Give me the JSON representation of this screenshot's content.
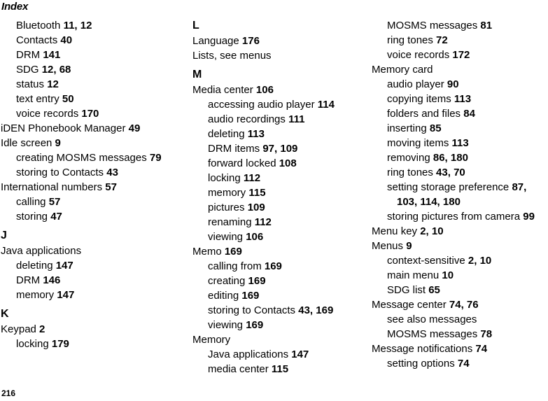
{
  "document": {
    "title": "Index",
    "page_number": "216"
  },
  "columns": [
    {
      "id": "column-1",
      "blocks": [
        {
          "type": "entry",
          "level": 1,
          "text": "Bluetooth ",
          "pages": "11, 12"
        },
        {
          "type": "entry",
          "level": 1,
          "text": "Contacts ",
          "pages": "40"
        },
        {
          "type": "entry",
          "level": 1,
          "text": "DRM ",
          "pages": "141"
        },
        {
          "type": "entry",
          "level": 1,
          "text": "SDG ",
          "pages": "12, 68"
        },
        {
          "type": "entry",
          "level": 1,
          "text": "status ",
          "pages": "12"
        },
        {
          "type": "entry",
          "level": 1,
          "text": "text entry ",
          "pages": "50"
        },
        {
          "type": "entry",
          "level": 1,
          "text": "voice records ",
          "pages": "170"
        },
        {
          "type": "entry",
          "level": 0,
          "text": "iDEN Phonebook Manager ",
          "pages": "49"
        },
        {
          "type": "entry",
          "level": 0,
          "text": "Idle screen ",
          "pages": "9"
        },
        {
          "type": "entry",
          "level": 1,
          "text": "creating MOSMS messages ",
          "pages": "79"
        },
        {
          "type": "entry",
          "level": 1,
          "text": "storing to Contacts ",
          "pages": "43"
        },
        {
          "type": "entry",
          "level": 0,
          "text": "International numbers ",
          "pages": "57"
        },
        {
          "type": "entry",
          "level": 1,
          "text": "calling ",
          "pages": "57"
        },
        {
          "type": "entry",
          "level": 1,
          "text": "storing ",
          "pages": "47"
        },
        {
          "type": "letter",
          "text": "J"
        },
        {
          "type": "entry",
          "level": 0,
          "text": "Java applications",
          "pages": ""
        },
        {
          "type": "entry",
          "level": 1,
          "text": "deleting ",
          "pages": "147"
        },
        {
          "type": "entry",
          "level": 1,
          "text": "DRM ",
          "pages": "146"
        },
        {
          "type": "entry",
          "level": 1,
          "text": "memory ",
          "pages": "147"
        },
        {
          "type": "letter",
          "text": "K"
        },
        {
          "type": "entry",
          "level": 0,
          "text": "Keypad ",
          "pages": "2"
        },
        {
          "type": "entry",
          "level": 1,
          "text": "locking ",
          "pages": "179"
        }
      ]
    },
    {
      "id": "column-2",
      "blocks": [
        {
          "type": "letter",
          "text": "L"
        },
        {
          "type": "entry",
          "level": 0,
          "text": "Language ",
          "pages": "176"
        },
        {
          "type": "entry",
          "level": 0,
          "text": "Lists, see menus",
          "pages": ""
        },
        {
          "type": "letter",
          "text": "M"
        },
        {
          "type": "entry",
          "level": 0,
          "text": "Media center ",
          "pages": "106"
        },
        {
          "type": "entry",
          "level": 1,
          "text": "accessing audio player ",
          "pages": "114"
        },
        {
          "type": "entry",
          "level": 1,
          "text": "audio recordings ",
          "pages": "111"
        },
        {
          "type": "entry",
          "level": 1,
          "text": "deleting ",
          "pages": "113"
        },
        {
          "type": "entry",
          "level": 1,
          "text": "DRM items ",
          "pages": "97, 109"
        },
        {
          "type": "entry",
          "level": 1,
          "text": "forward locked ",
          "pages": "108"
        },
        {
          "type": "entry",
          "level": 1,
          "text": "locking ",
          "pages": "112"
        },
        {
          "type": "entry",
          "level": 1,
          "text": "memory ",
          "pages": "115"
        },
        {
          "type": "entry",
          "level": 1,
          "text": "pictures ",
          "pages": "109"
        },
        {
          "type": "entry",
          "level": 1,
          "text": "renaming ",
          "pages": "112"
        },
        {
          "type": "entry",
          "level": 1,
          "text": "viewing ",
          "pages": "106"
        },
        {
          "type": "entry",
          "level": 0,
          "text": "Memo ",
          "pages": "169"
        },
        {
          "type": "entry",
          "level": 1,
          "text": "calling from ",
          "pages": "169"
        },
        {
          "type": "entry",
          "level": 1,
          "text": "creating ",
          "pages": "169"
        },
        {
          "type": "entry",
          "level": 1,
          "text": "editing ",
          "pages": "169"
        },
        {
          "type": "entry",
          "level": 1,
          "text": "storing to Contacts ",
          "pages": "43, 169"
        },
        {
          "type": "entry",
          "level": 1,
          "text": "viewing ",
          "pages": "169"
        },
        {
          "type": "entry",
          "level": 0,
          "text": "Memory",
          "pages": ""
        },
        {
          "type": "entry",
          "level": 1,
          "text": "Java applications ",
          "pages": "147"
        },
        {
          "type": "entry",
          "level": 1,
          "text": "media center ",
          "pages": "115"
        }
      ]
    },
    {
      "id": "column-3",
      "blocks": [
        {
          "type": "entry",
          "level": 1,
          "text": "MOSMS messages ",
          "pages": "81"
        },
        {
          "type": "entry",
          "level": 1,
          "text": "ring tones ",
          "pages": "72"
        },
        {
          "type": "entry",
          "level": 1,
          "text": "voice records ",
          "pages": "172"
        },
        {
          "type": "entry",
          "level": 0,
          "text": "Memory card",
          "pages": ""
        },
        {
          "type": "entry",
          "level": 1,
          "text": "audio player ",
          "pages": "90"
        },
        {
          "type": "entry",
          "level": 1,
          "text": "copying items ",
          "pages": "113"
        },
        {
          "type": "entry",
          "level": 1,
          "text": "folders and files ",
          "pages": "84"
        },
        {
          "type": "entry",
          "level": 1,
          "text": "inserting ",
          "pages": "85"
        },
        {
          "type": "entry",
          "level": 1,
          "text": "moving items ",
          "pages": "113"
        },
        {
          "type": "entry",
          "level": 1,
          "text": "removing ",
          "pages": "86, 180"
        },
        {
          "type": "entry",
          "level": 1,
          "text": "ring tones ",
          "pages": "43, 70"
        },
        {
          "type": "entry",
          "level": 1,
          "text": "setting storage preference ",
          "pages": "87, 103, 114, 180"
        },
        {
          "type": "entry",
          "level": 1,
          "text": "storing pictures from camera ",
          "pages": "99"
        },
        {
          "type": "entry",
          "level": 0,
          "text": "Menu key ",
          "pages": "2, 10"
        },
        {
          "type": "entry",
          "level": 0,
          "text": "Menus ",
          "pages": "9"
        },
        {
          "type": "entry",
          "level": 1,
          "text": "context-sensitive ",
          "pages": "2, 10"
        },
        {
          "type": "entry",
          "level": 1,
          "text": "main menu ",
          "pages": "10"
        },
        {
          "type": "entry",
          "level": 1,
          "text": "SDG list ",
          "pages": "65"
        },
        {
          "type": "entry",
          "level": 0,
          "text": "Message center ",
          "pages": "74, 76"
        },
        {
          "type": "entry",
          "level": 1,
          "text": "see also messages",
          "pages": ""
        },
        {
          "type": "entry",
          "level": 1,
          "text": "MOSMS messages ",
          "pages": "78"
        },
        {
          "type": "entry",
          "level": 0,
          "text": "Message notifications ",
          "pages": "74"
        },
        {
          "type": "entry",
          "level": 1,
          "text": "setting options ",
          "pages": "74"
        }
      ]
    }
  ]
}
